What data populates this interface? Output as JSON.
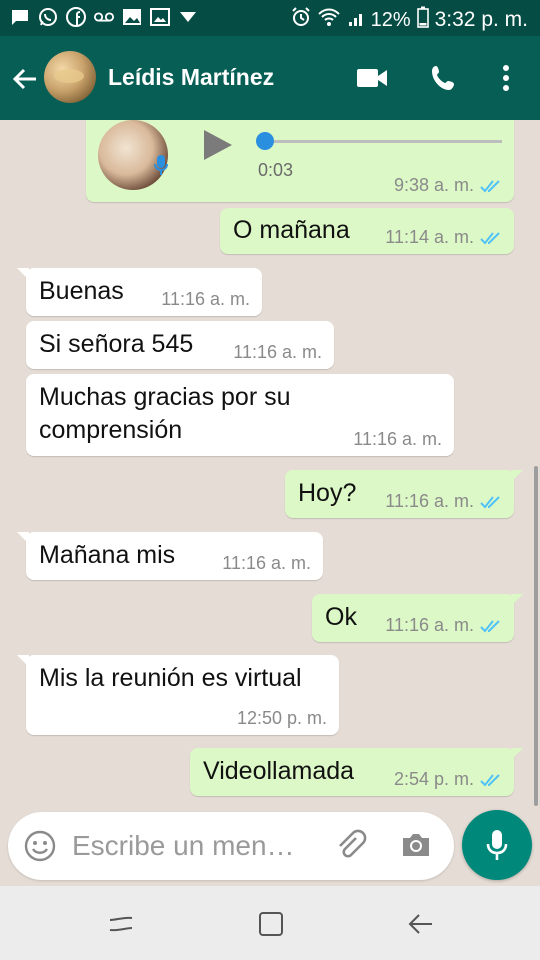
{
  "status_bar": {
    "battery": "12%",
    "time": "3:32 p. m.",
    "icons": [
      "chat-icon",
      "whatsapp-icon",
      "facebook-icon",
      "voicemail-icon",
      "gallery-icon",
      "image-icon",
      "dropdown-icon",
      "alarm-icon",
      "wifi-icon",
      "signal-icon",
      "battery-icon"
    ]
  },
  "header": {
    "contact_name": "Leídis Martínez",
    "actions": [
      "back-icon",
      "video-call-icon",
      "phone-icon",
      "more-icon"
    ]
  },
  "messages": [
    {
      "type": "voice",
      "direction": "out",
      "duration": "0:03",
      "time": "9:38 a. m.",
      "status": "read"
    },
    {
      "type": "text",
      "direction": "out",
      "text": "O mañana",
      "time": "11:14 a. m.",
      "status": "read"
    },
    {
      "type": "text",
      "direction": "in",
      "text": "Buenas",
      "time": "11:16 a. m."
    },
    {
      "type": "text",
      "direction": "in",
      "text": "Si señora 545",
      "time": "11:16 a. m."
    },
    {
      "type": "text",
      "direction": "in",
      "text_lines": [
        "Muchas gracias por su",
        "comprensión"
      ],
      "time": "11:16 a. m."
    },
    {
      "type": "text",
      "direction": "out",
      "text": "Hoy?",
      "time": "11:16 a. m.",
      "status": "read"
    },
    {
      "type": "text",
      "direction": "in",
      "text": "Mañana mis",
      "time": "11:16 a. m."
    },
    {
      "type": "text",
      "direction": "out",
      "text": "Ok",
      "time": "11:16 a. m.",
      "status": "read"
    },
    {
      "type": "text",
      "direction": "in",
      "text": "Mis la reunión es virtual",
      "time": "12:50 p. m."
    },
    {
      "type": "text",
      "direction": "out",
      "text": "Videollamada",
      "time": "2:54 p. m.",
      "status": "read"
    }
  ],
  "composer": {
    "placeholder": "Escribe un men…"
  },
  "colors": {
    "header": "#075e54",
    "status_bar": "#054d44",
    "outgoing_bubble": "#dcf8c6",
    "incoming_bubble": "#ffffff",
    "chat_background": "#e5ddd5",
    "read_ticks": "#4fc3f7",
    "mic_button": "#00897b"
  }
}
